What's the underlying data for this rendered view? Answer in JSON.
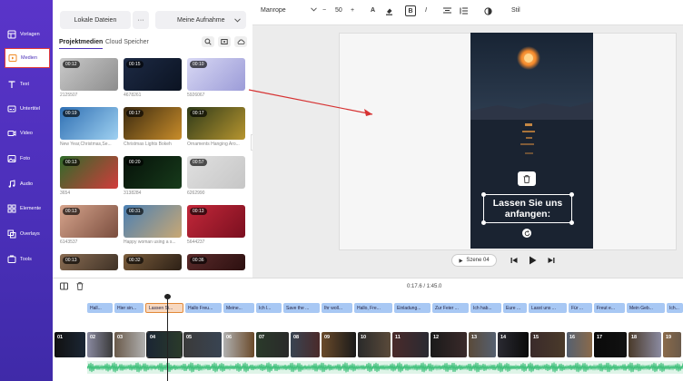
{
  "sidebar": {
    "items": [
      {
        "label": "Vorlagen",
        "icon": "template-icon"
      },
      {
        "label": "Medien",
        "icon": "media-icon"
      },
      {
        "label": "Text",
        "icon": "text-icon"
      },
      {
        "label": "Untertitel",
        "icon": "subtitle-icon"
      },
      {
        "label": "Video",
        "icon": "video-icon"
      },
      {
        "label": "Foto",
        "icon": "photo-icon"
      },
      {
        "label": "Audio",
        "icon": "audio-icon"
      },
      {
        "label": "Elemente",
        "icon": "elements-icon"
      },
      {
        "label": "Overlays",
        "icon": "overlays-icon"
      },
      {
        "label": "Tools",
        "icon": "tools-icon"
      }
    ],
    "accent": "#4a2fb8"
  },
  "media": {
    "local_button": "Lokale Dateien",
    "more_button": "···",
    "album_select": "Meine Aufnahme",
    "tab_project": "Projektmedien",
    "tab_cloud": "Cloud Speicher",
    "items": [
      {
        "dur": "00:12",
        "caption": "2125507",
        "colors": [
          "#c9c9c9",
          "#8d8d8d"
        ]
      },
      {
        "dur": "00:15",
        "caption": "4678261",
        "colors": [
          "#1d2a44",
          "#0b1322"
        ]
      },
      {
        "dur": "00:10",
        "caption": "5926067",
        "colors": [
          "#d8d8f4",
          "#9c9cd8"
        ]
      },
      {
        "dur": "00:19",
        "caption": "New Year,Christmas,Se...",
        "colors": [
          "#2f6fb3",
          "#9fd1f1"
        ]
      },
      {
        "dur": "00:17",
        "caption": "Christmas Lights Bokeh",
        "colors": [
          "#3b2a10",
          "#c98d2a"
        ]
      },
      {
        "dur": "00:17",
        "caption": "Ornaments Hanging Aro...",
        "colors": [
          "#2e3a19",
          "#b7952f"
        ]
      },
      {
        "dur": "00:13",
        "caption": "3654",
        "colors": [
          "#2e6b2a",
          "#d23b3b"
        ]
      },
      {
        "dur": "00:20",
        "caption": "3138284",
        "colors": [
          "#061109",
          "#173b1b"
        ]
      },
      {
        "dur": "00:57",
        "caption": "6262990",
        "colors": [
          "#e0e0e0",
          "#c6c6c6"
        ]
      },
      {
        "dur": "00:13",
        "caption": "6143537",
        "colors": [
          "#d7a58d",
          "#7a4d3e"
        ]
      },
      {
        "dur": "00:31",
        "caption": "Happy woman using a s...",
        "colors": [
          "#4a7fb3",
          "#c9a874"
        ]
      },
      {
        "dur": "00:13",
        "caption": "5644237",
        "colors": [
          "#c3283a",
          "#7a0f1f"
        ]
      },
      {
        "dur": "00:13",
        "caption": "",
        "colors": [
          "#8a6d53",
          "#3e3126"
        ]
      },
      {
        "dur": "00:32",
        "caption": "",
        "colors": [
          "#7b5d3c",
          "#2c2016"
        ]
      },
      {
        "dur": "00:36",
        "caption": "",
        "colors": [
          "#5a2a2a",
          "#2c1010"
        ]
      }
    ]
  },
  "toolbar": {
    "font": "Manrope",
    "minus": "−",
    "size": "50",
    "plus": "+",
    "text_color": "A",
    "bold": "B",
    "italic": "I",
    "style": "Stil"
  },
  "canvas": {
    "text_line1": "Lassen Sie uns",
    "text_line2": "anfangen:",
    "scene_label": "Szene 04"
  },
  "timeline": {
    "time": "0:17.6 / 1:45.0",
    "text_clips": [
      "Hall...",
      "Hier sin...",
      "Lassen Si...",
      "Hallo Freu...",
      "Meine...",
      "Ich l...",
      "Save the ...",
      "Ihr woll...",
      "Hallo, Fre...",
      "Einladung...",
      "Zur Feier ...",
      "Ich hab...",
      "Eure ...",
      "Lasst uns ...",
      "Für ...",
      "Freut e...",
      "Mein Geb...",
      "Ich..."
    ],
    "video_clips": [
      "01",
      "02",
      "03",
      "04",
      "05",
      "06",
      "07",
      "08",
      "09",
      "10",
      "11",
      "12",
      "13",
      "14",
      "15",
      "16",
      "17",
      "18",
      "19"
    ]
  }
}
